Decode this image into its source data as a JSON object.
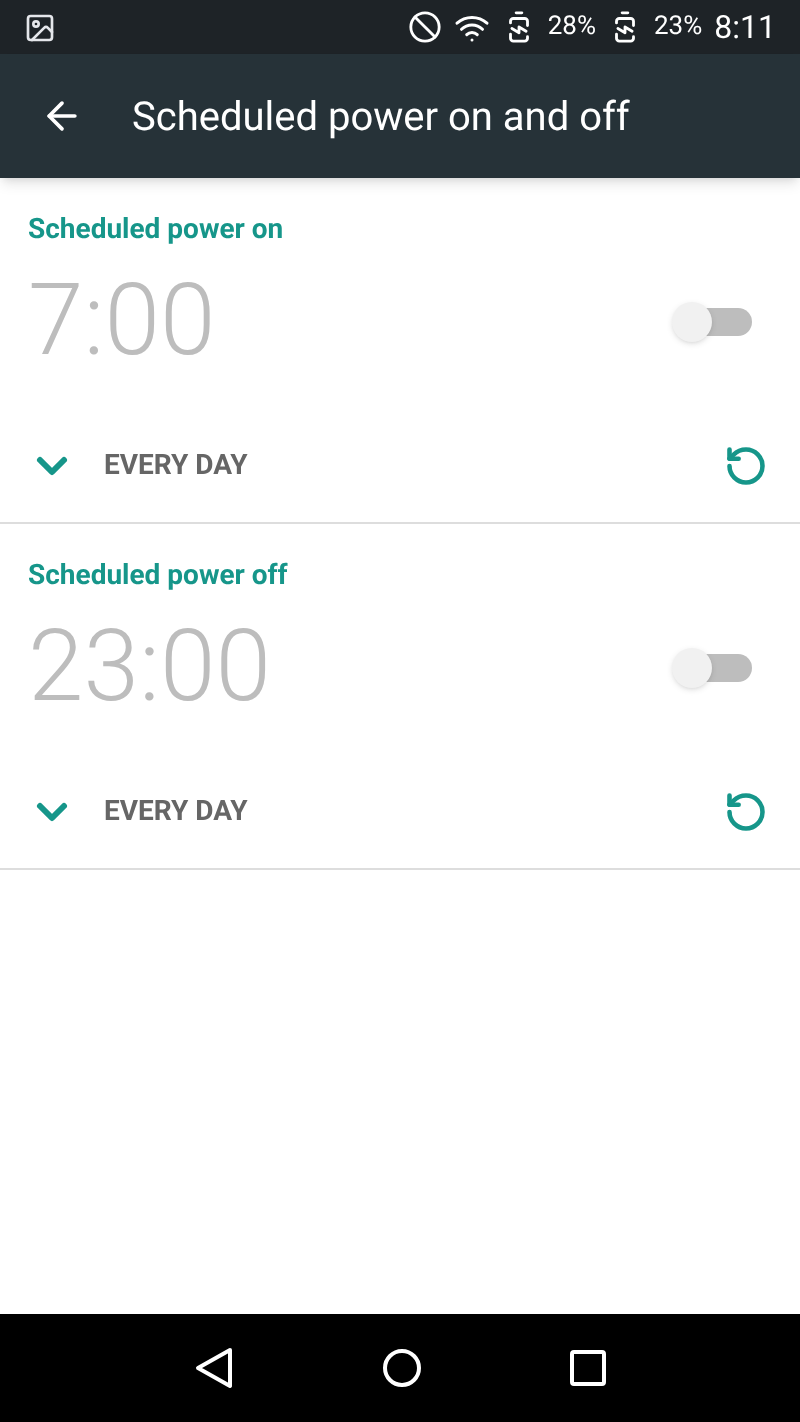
{
  "status_bar": {
    "battery_1": "28%",
    "battery_2": "23%",
    "time": "8:11"
  },
  "app_bar": {
    "title": "Scheduled power on and off"
  },
  "schedules": [
    {
      "title": "Scheduled power on",
      "time": "7:00",
      "on": false,
      "expanded": false,
      "repeat": "EVERY DAY"
    },
    {
      "title": "Scheduled power off",
      "time": "23:00",
      "on": false,
      "expanded": false,
      "repeat": "EVERY DAY"
    }
  ]
}
